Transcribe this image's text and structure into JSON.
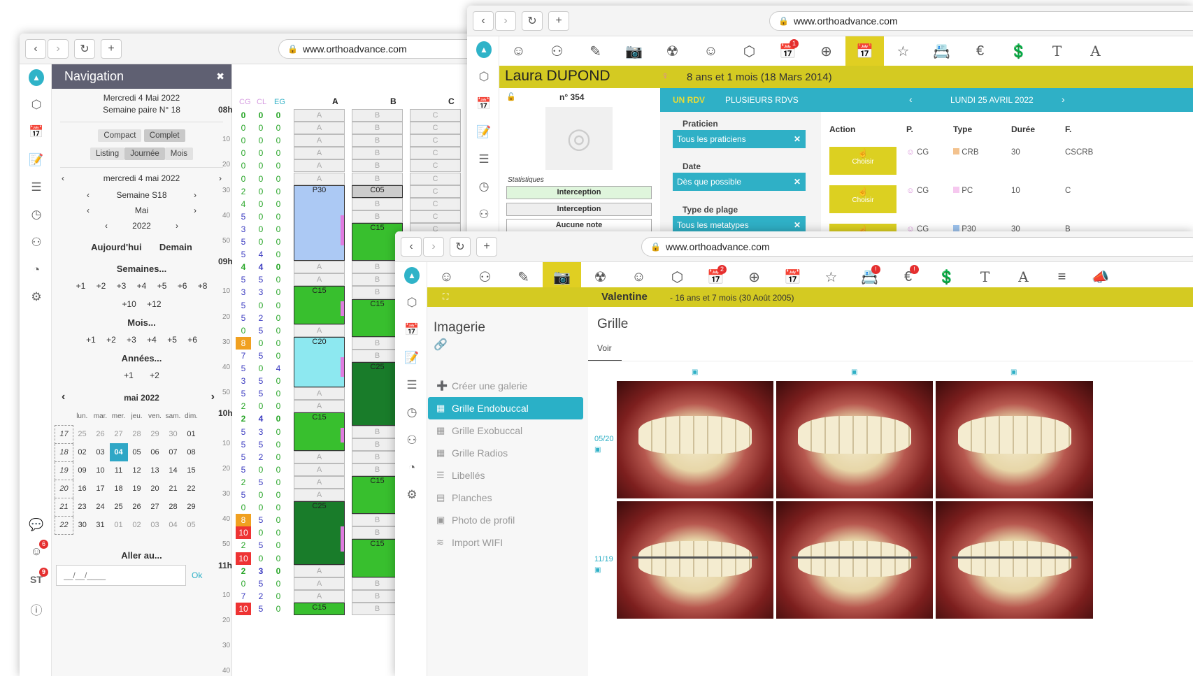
{
  "browser": {
    "url": "www.orthoadvance.com"
  },
  "nav": {
    "title": "Navigation",
    "date_line": "Mercredi 4 Mai 2022",
    "week_line": "Semaine paire N° 18",
    "view1": "Compact",
    "view2": "Complet",
    "view3": "Listing",
    "view4": "Journée",
    "view5": "Mois",
    "day": "mercredi 4 mai 2022",
    "week": "Semaine S18",
    "month": "Mai",
    "year": "2022",
    "today": "Aujourd'hui",
    "tomorrow": "Demain",
    "weeks_label": "Semaines...",
    "months_label": "Mois...",
    "years_label": "Années...",
    "weeks": [
      "+1",
      "+2",
      "+3",
      "+4",
      "+5",
      "+6",
      "+8",
      "+10",
      "+12"
    ],
    "months": [
      "+1",
      "+2",
      "+3",
      "+4",
      "+5",
      "+6"
    ],
    "years": [
      "+1",
      "+2"
    ],
    "cal_title": "mai 2022",
    "dow": [
      "lun.",
      "mar.",
      "mer.",
      "jeu.",
      "ven.",
      "sam.",
      "dim."
    ],
    "cal_rows": [
      [
        "17",
        "25",
        "26",
        "27",
        "28",
        "29",
        "30",
        "01"
      ],
      [
        "18",
        "02",
        "03",
        "04",
        "05",
        "06",
        "07",
        "08"
      ],
      [
        "19",
        "09",
        "10",
        "11",
        "12",
        "13",
        "14",
        "15"
      ],
      [
        "20",
        "16",
        "17",
        "18",
        "19",
        "20",
        "21",
        "22"
      ],
      [
        "21",
        "23",
        "24",
        "25",
        "26",
        "27",
        "28",
        "29"
      ],
      [
        "22",
        "30",
        "31",
        "01",
        "02",
        "03",
        "04",
        "05"
      ]
    ],
    "goto_label": "Aller au...",
    "goto_placeholder": "__/__/____",
    "ok": "Ok"
  },
  "badges": {
    "chat": "6",
    "st": "9",
    "st_label": "ST"
  },
  "schedule": {
    "headers": [
      "CG",
      "CL",
      "EG",
      "A",
      "B",
      "C"
    ],
    "hours": [
      "08h",
      "09h",
      "10h",
      "11h"
    ],
    "minutes": [
      "10",
      "20",
      "30",
      "40",
      "50"
    ],
    "rows": [
      [
        "0",
        "0",
        "0"
      ],
      [
        "0",
        "0",
        "0"
      ],
      [
        "0",
        "0",
        "0"
      ],
      [
        "0",
        "0",
        "0"
      ],
      [
        "0",
        "0",
        "0"
      ],
      [
        "0",
        "0",
        "0"
      ],
      [
        "2",
        "0",
        "0"
      ],
      [
        "4",
        "0",
        "0"
      ],
      [
        "5",
        "0",
        "0"
      ],
      [
        "3",
        "0",
        "0"
      ],
      [
        "5",
        "0",
        "0"
      ],
      [
        "5",
        "4",
        "0"
      ],
      [
        "4",
        "4",
        "0"
      ],
      [
        "5",
        "5",
        "0"
      ],
      [
        "3",
        "3",
        "0"
      ],
      [
        "5",
        "0",
        "0"
      ],
      [
        "5",
        "2",
        "0"
      ],
      [
        "0",
        "5",
        "0"
      ],
      [
        "8",
        "0",
        "0"
      ],
      [
        "7",
        "5",
        "0"
      ],
      [
        "5",
        "0",
        "4"
      ],
      [
        "3",
        "5",
        "0"
      ],
      [
        "5",
        "5",
        "0"
      ],
      [
        "2",
        "0",
        "0"
      ],
      [
        "2",
        "4",
        "0"
      ],
      [
        "5",
        "3",
        "0"
      ],
      [
        "5",
        "5",
        "0"
      ],
      [
        "5",
        "2",
        "0"
      ],
      [
        "5",
        "0",
        "0"
      ],
      [
        "2",
        "5",
        "0"
      ],
      [
        "5",
        "0",
        "0"
      ],
      [
        "0",
        "0",
        "0"
      ],
      [
        "8",
        "5",
        "0"
      ],
      [
        "10",
        "0",
        "0"
      ],
      [
        "2",
        "5",
        "0"
      ],
      [
        "10",
        "0",
        "0"
      ],
      [
        "2",
        "3",
        "0"
      ],
      [
        "0",
        "5",
        "0"
      ],
      [
        "7",
        "2",
        "0"
      ],
      [
        "10",
        "5",
        "0"
      ]
    ],
    "blocks": [
      {
        "label": "P30"
      },
      {
        "label": "C05"
      },
      {
        "label": "C15"
      },
      {
        "label": "C15"
      },
      {
        "label": "C15"
      },
      {
        "label": "C20"
      },
      {
        "label": "C25"
      },
      {
        "label": "C15"
      },
      {
        "label": "C15"
      },
      {
        "label": "C25"
      },
      {
        "label": "C15"
      },
      {
        "label": "C15"
      }
    ],
    "empty_a": "A",
    "empty_b": "B",
    "empty_c": "C"
  },
  "laura": {
    "name": "Laura DUPOND",
    "age": "8 ans et 1 mois (18 Mars 2014)",
    "file_no": "n° 354",
    "stats_label": "Statistiques",
    "stat1": "Interception",
    "stat2": "Interception",
    "stat3": "Aucune note",
    "tab1": "UN RDV",
    "tab2": "PLUSIEURS RDVS",
    "date": "LUNDI 25 AVRIL 2022",
    "f_praticien": "Praticien",
    "v_praticien": "Tous les praticiens",
    "f_date": "Date",
    "v_date": "Dès que possible",
    "f_type": "Type de plage",
    "v_type": "Tous les metatypes",
    "cols": [
      "Action",
      "P.",
      "Type",
      "Durée",
      "F."
    ],
    "rows": [
      {
        "p": "CG",
        "type": "CRB",
        "dur": "30",
        "f": "CSCRB",
        "color": "#f3c28e"
      },
      {
        "p": "CG",
        "type": "PC",
        "dur": "10",
        "f": "C",
        "color": "#f6c8ef"
      },
      {
        "p": "CG",
        "type": "P30",
        "dur": "30",
        "f": "B",
        "color": "#9ec4ef"
      }
    ],
    "choose": "Choisir",
    "agenda_badge": "1"
  },
  "val": {
    "name": "Valentine",
    "age": "- 16 ans et 7 mois (30 Août 2005)",
    "section": "Imagerie",
    "title": "Grille",
    "tab": "Voir",
    "menu": [
      "Créer une galerie",
      "Grille Endobuccal",
      "Grille Exobuccal",
      "Grille Radios",
      "Libellés",
      "Planches",
      "Photo de profil",
      "Import WIFI"
    ],
    "row1_date": "05/20",
    "row2_date": "11/19",
    "agenda_badge": "2",
    "badge_alert": "!"
  }
}
